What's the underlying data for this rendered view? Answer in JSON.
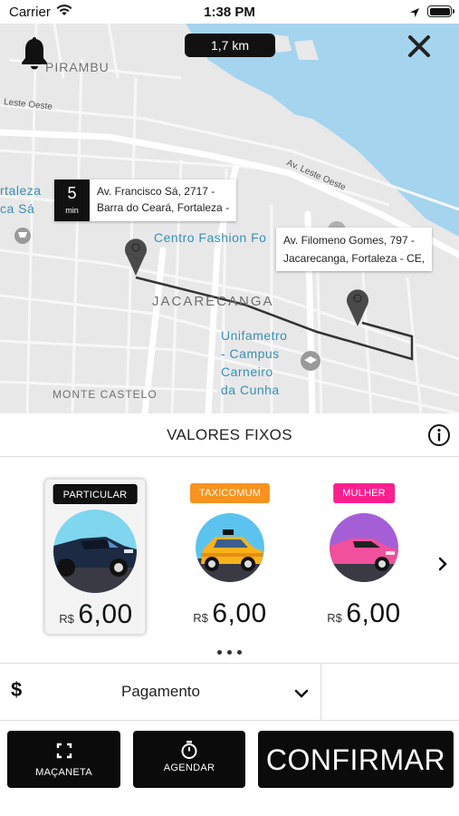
{
  "status_bar": {
    "carrier": "Carrier",
    "time": "1:38 PM"
  },
  "map": {
    "distance": "1,7 km",
    "labels": {
      "pirambu": "PIRAMBU",
      "leste_oeste": "Leste Oeste",
      "av_leste_oeste": "Av. Leste Oeste",
      "fortaleza_line1": "rtaleza",
      "fortaleza_line2": "ca Sá",
      "centro_fashion": "Centro Fashion Fo",
      "jacarecanga": "JACARECANGA",
      "unifametro_1": "Unifametro",
      "unifametro_2": "- Campus",
      "unifametro_3": "Carneiro",
      "unifametro_4": "da Cunha",
      "monte_castelo": "MONTE CASTELO"
    },
    "origin": {
      "eta_value": "5",
      "eta_unit": "min",
      "address_line1": "Av. Francisco Sá, 2717 -",
      "address_line2": "Barra do Ceará, Fortaleza -"
    },
    "destination": {
      "address_line1": "Av. Filomeno Gomes, 797 -",
      "address_line2": "Jacarecanga, Fortaleza - CE,"
    }
  },
  "fixed_values": {
    "title": "VALORES FIXOS"
  },
  "categories": [
    {
      "tag": "PARTICULAR",
      "tag_color": "#111111",
      "currency": "R$",
      "price": "6,00",
      "selected": true
    },
    {
      "tag": "TAXICOMUM",
      "tag_color": "#f7931e",
      "currency": "R$",
      "price": "6,00",
      "selected": false
    },
    {
      "tag": "MULHER",
      "tag_color": "#ff1f8e",
      "currency": "R$",
      "price": "6,00",
      "selected": false
    }
  ],
  "payment": {
    "icon": "$",
    "label": "Pagamento"
  },
  "actions": {
    "macaneta": "MAÇANETA",
    "agendar": "AGENDAR",
    "confirmar": "CONFIRMAR"
  }
}
